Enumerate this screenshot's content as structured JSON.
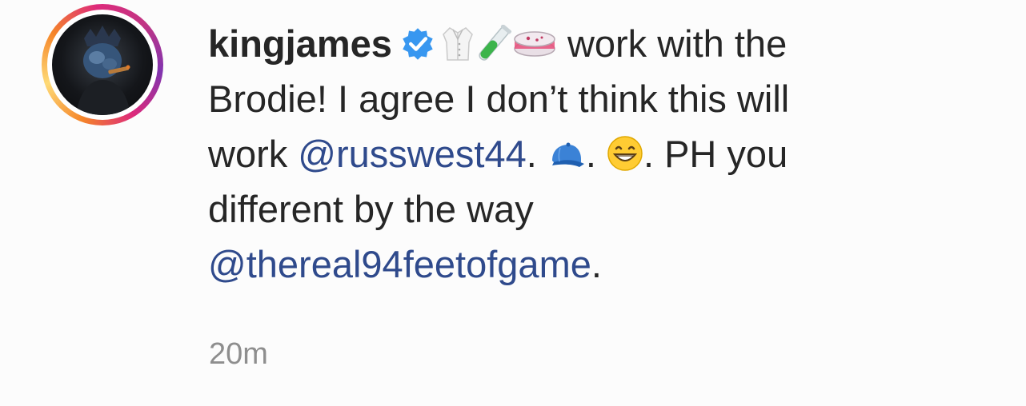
{
  "comment": {
    "username": "kingjames",
    "verified_icon": "verified-badge-icon",
    "emoji_1": "lab-coat-emoji",
    "emoji_2": "test-tube-emoji",
    "emoji_3": "petri-dish-emoji",
    "text_1": " work with the",
    "text_2": "Brodie! I agree I don’t think this will",
    "text_3a": "work ",
    "mention_1": "@russwest44",
    "text_3b": ". ",
    "emoji_4": "billed-cap-emoji",
    "text_3c": ". ",
    "emoji_5": "grinning-face-emoji",
    "text_3d": ". PH you",
    "text_4": "different by the way",
    "mention_2": "@thereal94feetofgame",
    "text_5": ".",
    "timestamp": "20m"
  },
  "colors": {
    "mention": "#2f4a8c",
    "verified": "#3897f0",
    "timestamp": "#8e8e8e"
  }
}
